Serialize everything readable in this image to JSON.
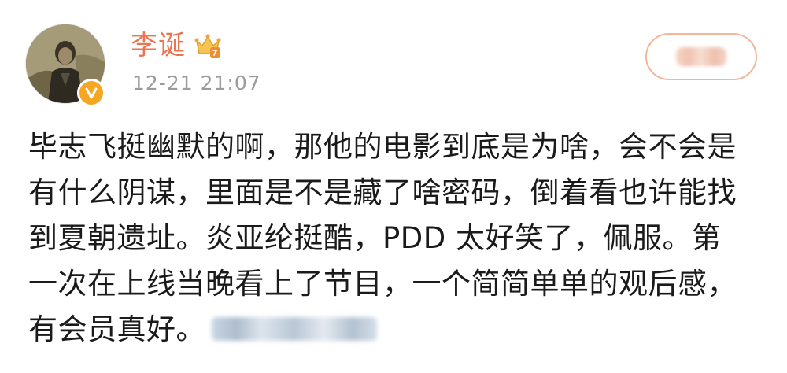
{
  "post": {
    "username": "李诞",
    "timestamp": "12-21 21:07",
    "vip_level_icon": "crown-vip-icon",
    "verified_icon": "verified-v-icon",
    "follow_button_state": "blurred",
    "content_lines": [
      "毕志飞挺幽默的啊，那他的电影到底是为啥，会不会是",
      "有什么阴谋，里面是不是藏了啥密码，倒着看也许能找",
      "到夏朝遗址。炎亚纶挺酷，PDD 太好笑了，佩服。第",
      "一次在上线当晚看上了节目，一个简简单单的观后感，",
      "有会员真好。"
    ],
    "blurred_tail": "blurred-link"
  },
  "colors": {
    "username": "#eb7350",
    "timestamp": "#9b9b9b",
    "text": "#1a1a1a",
    "follow_border": "#f4b59b",
    "badge": "#f5a623"
  }
}
